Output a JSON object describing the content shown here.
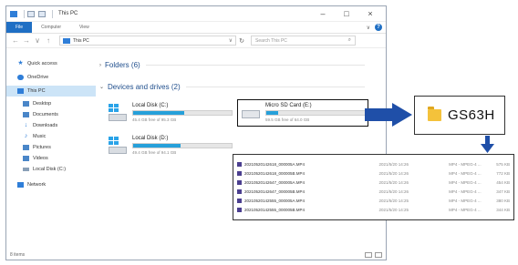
{
  "window": {
    "title": "This PC",
    "controls": {
      "minimize": "–",
      "maximize": "□",
      "close": "×"
    }
  },
  "ribbon": {
    "tabs": [
      "File",
      "Computer",
      "View"
    ],
    "collapse_chevron": "∨",
    "help": "?"
  },
  "navbar": {
    "back": "←",
    "forward": "→",
    "recent": "∨",
    "up": "↑",
    "address": "This PC",
    "address_caret": "∨",
    "refresh": "↻",
    "search_placeholder": "Search This PC",
    "search_icon": "⌕"
  },
  "nav_pane": {
    "items": [
      {
        "label": "Quick access",
        "icon": "star-icon"
      },
      {
        "label": "OneDrive",
        "icon": "cloud-icon"
      },
      {
        "label": "This PC",
        "icon": "pc-icon",
        "selected": true
      },
      {
        "label": "Desktop",
        "icon": "desktop-icon"
      },
      {
        "label": "Documents",
        "icon": "documents-icon"
      },
      {
        "label": "Downloads",
        "icon": "download-icon"
      },
      {
        "label": "Music",
        "icon": "music-icon"
      },
      {
        "label": "Pictures",
        "icon": "pictures-icon"
      },
      {
        "label": "Videos",
        "icon": "videos-icon"
      },
      {
        "label": "Local Disk (C:)",
        "icon": "disk-icon"
      },
      {
        "label": "Network",
        "icon": "network-icon"
      }
    ]
  },
  "content": {
    "folders_header": "Folders (6)",
    "devices_header": "Devices and drives (2)",
    "drives": [
      {
        "name": "Local Disk (C:)",
        "free": "45.4 GB free of 95.3 GB",
        "used_fraction": 0.52
      },
      {
        "name": "Micro SD Card  (E:)",
        "free": "59.5 GB free of 64.0 GB",
        "used_fraction": 0.12
      },
      {
        "name": "Local Disk (D:)",
        "free": "49.4 GB free of 94.1 GB",
        "used_fraction": 0.48
      }
    ]
  },
  "status": {
    "items": "8 items"
  },
  "callout_folder": {
    "name": "GS63H",
    "icon": "folder-icon"
  },
  "callout_files": {
    "rows": [
      {
        "name": "20210520142618_000005A.MP4",
        "date": "2021/5/20 14:26",
        "type": "MP4 - MPEG-4 ...",
        "size": "575 KB"
      },
      {
        "name": "20210520142618_000005B.MP4",
        "date": "2021/5/20 14:26",
        "type": "MP4 - MPEG-4 ...",
        "size": "772 KB"
      },
      {
        "name": "20210520142647_000005A.MP4",
        "date": "2021/5/20 14:26",
        "type": "MP4 - MPEG-4 ...",
        "size": "454 KB"
      },
      {
        "name": "20210520142647_000005B.MP4",
        "date": "2021/5/20 14:26",
        "type": "MP4 - MPEG-4 ...",
        "size": "347 KB"
      },
      {
        "name": "20210520142555_000005A.MP4",
        "date": "2021/5/20 14:25",
        "type": "MP4 - MPEG-4 ...",
        "size": "380 KB"
      },
      {
        "name": "20210520142555_000005B.MP4",
        "date": "2021/5/20 14:25",
        "type": "MP4 - MPEG-4 ...",
        "size": "344 KB"
      }
    ]
  },
  "colors": {
    "accent": "#1f6fc4",
    "bar_fill": "#26a0da",
    "arrow": "#1f4fa8"
  }
}
